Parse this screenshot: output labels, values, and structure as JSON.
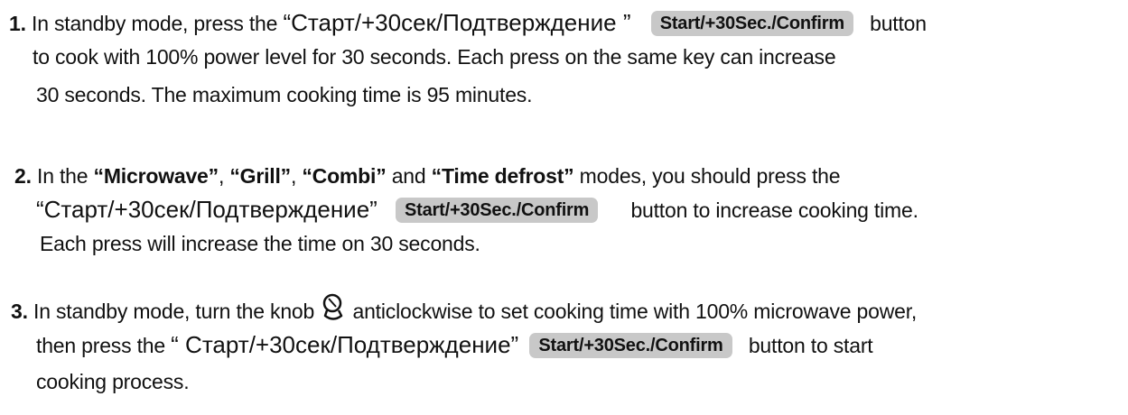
{
  "button_label": "Start/+30Sec./Confirm",
  "item1": {
    "num": "1.",
    "t1": "In standby mode, press the ",
    "ru": "“Старт/+30сек/Подтверждение ”",
    "t2": "button",
    "line2": "to cook with 100% power level for 30 seconds. Each press on the same key can increase",
    "line3": "30 seconds. The maximum cooking time is 95 minutes."
  },
  "item2": {
    "num": "2.",
    "t1": "In the ",
    "k1": "“Microwave”",
    "s1": ", ",
    "k2": "“Grill”",
    "s2": ", ",
    "k3": "“Combi”",
    "s3": " and ",
    "k4": "“Time defrost”",
    "t2": " modes, you should press the",
    "ru": "“Старт/+30сек/Подтверждение”",
    "t3": "button to increase cooking time.",
    "line3": "Each press will increase the time on 30 seconds."
  },
  "item3": {
    "num": "3.",
    "t1": "In standby mode, turn the knob ",
    "knob_icon": "knob-icon",
    "t2": " anticlockwise to set cooking time with 100% microwave power,",
    "t3": "then press the ",
    "ru": "“ Старт/+30сек/Подтверждение”",
    "t4": "button  to start",
    "line3": "cooking process."
  }
}
